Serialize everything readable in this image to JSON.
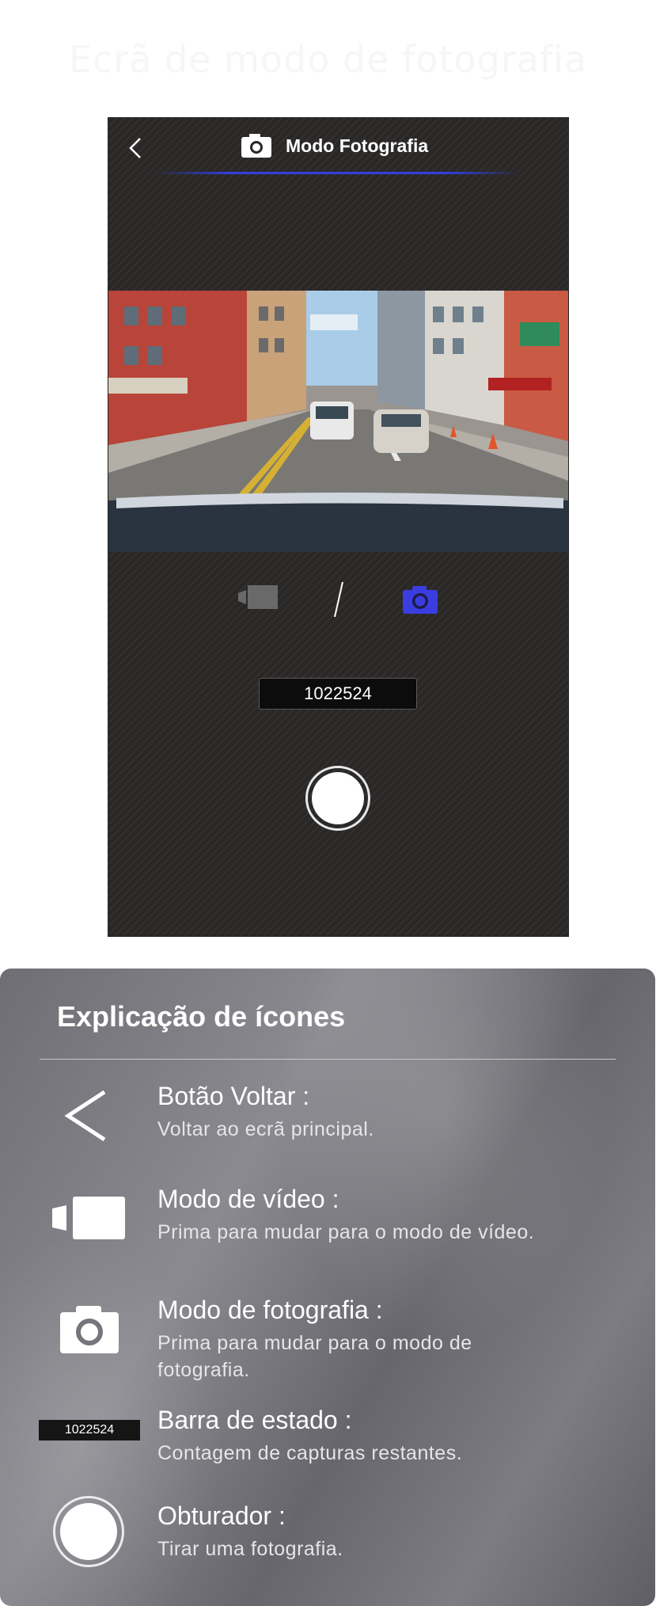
{
  "page": {
    "heading": "Ecrã de modo de fotografia"
  },
  "screen": {
    "header_title": "Modo Fotografia",
    "status_count": "1022524"
  },
  "icons": {
    "back": "chevron-left-icon",
    "camera": "camera-icon",
    "video": "video-camera-icon",
    "shutter": "shutter-icon"
  },
  "colors": {
    "accent": "#3a3ee0",
    "screen_bg": "#2a2727"
  },
  "legend": {
    "title": "Explicação de ícones",
    "items": [
      {
        "title": "Botão Voltar :",
        "desc": "Voltar ao ecrã principal."
      },
      {
        "title": "Modo de vídeo :",
        "desc": "Prima para mudar para o modo de vídeo."
      },
      {
        "title": "Modo de fotografia :",
        "desc": "Prima para mudar para o modo de fotografia."
      },
      {
        "title": "Barra de estado :",
        "desc": "Contagem de capturas restantes."
      },
      {
        "title": "Obturador :",
        "desc": "Tirar uma fotografia."
      }
    ],
    "status_sample": "1022524"
  }
}
